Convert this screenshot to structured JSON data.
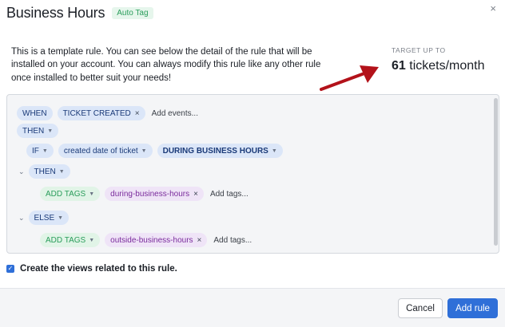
{
  "header": {
    "title": "Business Hours",
    "badge": "Auto Tag",
    "close_glyph": "×"
  },
  "description": "This is a template rule. You can see below the detail of the rule that will be installed on your account. You can always modify this rule like any other rule once installed to better suit your needs!",
  "target": {
    "label": "TARGET UP TO",
    "count": "61",
    "unit": "tickets/month"
  },
  "rule": {
    "when_label": "WHEN",
    "event": "TICKET CREATED",
    "add_events_placeholder": "Add events...",
    "then_label": "THEN",
    "if_label": "IF",
    "condition_field": "created date of ticket",
    "condition_value": "DURING BUSINESS HOURS",
    "inner_then_label": "THEN",
    "then_action": "ADD TAGS",
    "then_tag": "during-business-hours",
    "add_tags_placeholder": "Add tags...",
    "else_label": "ELSE",
    "else_action": "ADD TAGS",
    "else_tag": "outside-business-hours",
    "add_tags_placeholder_2": "Add tags..."
  },
  "views_checkbox": {
    "label": "Create the views related to this rule.",
    "checked": true
  },
  "footer": {
    "cancel_label": "Cancel",
    "add_label": "Add rule"
  },
  "colors": {
    "primary": "#2f6fd8",
    "arrow": "#b3121a",
    "pill_blue": "#dbe6f8",
    "pill_green": "#e1f4e7",
    "pill_purple": "#efe4f7"
  }
}
